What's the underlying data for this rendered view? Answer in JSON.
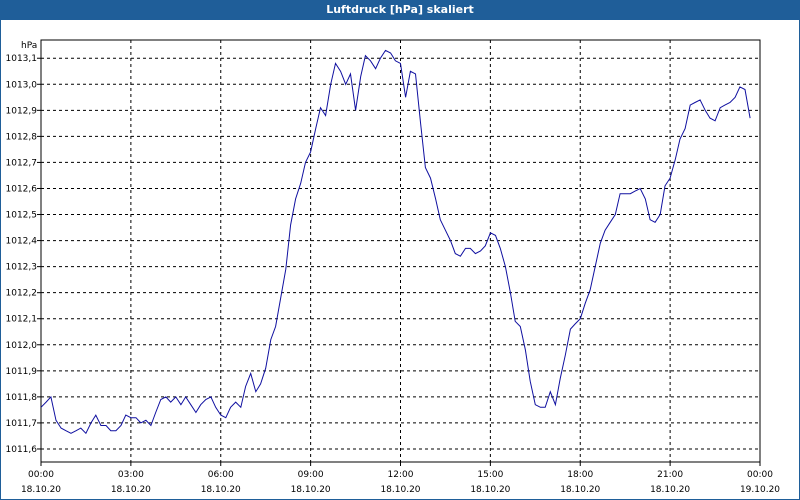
{
  "chart_data": {
    "type": "line",
    "title": "Luftdruck [hPa] skaliert",
    "ylabel": "hPa",
    "xlabel": "",
    "ylim": [
      1011.55,
      1013.17
    ],
    "yticks": [
      "1011,6",
      "1011,7",
      "1011,8",
      "1011,9",
      "1012,0",
      "1012,1",
      "1012,2",
      "1012,3",
      "1012,4",
      "1012,5",
      "1012,6",
      "1012,7",
      "1012,8",
      "1012,9",
      "1013,0",
      "1013,1"
    ],
    "xticks": [
      {
        "time": "00:00",
        "date": "18.10.20"
      },
      {
        "time": "03:00",
        "date": "18.10.20"
      },
      {
        "time": "06:00",
        "date": "18.10.20"
      },
      {
        "time": "09:00",
        "date": "18.10.20"
      },
      {
        "time": "12:00",
        "date": "18.10.20"
      },
      {
        "time": "15:00",
        "date": "18.10.20"
      },
      {
        "time": "18:00",
        "date": "18.10.20"
      },
      {
        "time": "21:00",
        "date": "18.10.20"
      },
      {
        "time": "00:00",
        "date": "19.10.20"
      }
    ],
    "grid": true,
    "line_color": "#1010a0",
    "series": [
      {
        "x_hours": [
          0.0,
          0.17,
          0.33,
          0.5,
          0.67,
          0.83,
          1.0,
          1.17,
          1.33,
          1.5,
          1.67,
          1.83,
          2.0,
          2.17,
          2.33,
          2.5,
          2.67,
          2.83,
          3.0,
          3.17,
          3.33,
          3.5,
          3.67,
          3.83,
          4.0,
          4.17,
          4.33,
          4.5,
          4.67,
          4.83,
          5.0,
          5.17,
          5.33,
          5.5,
          5.67,
          5.83,
          6.0,
          6.17,
          6.33,
          6.5,
          6.67,
          6.83,
          7.0,
          7.17,
          7.33,
          7.5,
          7.67,
          7.83,
          8.0,
          8.17,
          8.33,
          8.5,
          8.67,
          8.83,
          9.0,
          9.17,
          9.33,
          9.5,
          9.67,
          9.83,
          10.0,
          10.17,
          10.33,
          10.5,
          10.67,
          10.83,
          11.0,
          11.17,
          11.33,
          11.5,
          11.67,
          11.83,
          12.0,
          12.17,
          12.33,
          12.5,
          12.67,
          12.83,
          13.0,
          13.17,
          13.33,
          13.5,
          13.67,
          13.83,
          14.0,
          14.17,
          14.33,
          14.5,
          14.67,
          14.83,
          15.0,
          15.17,
          15.33,
          15.5,
          15.67,
          15.83,
          16.0,
          16.17,
          16.33,
          16.5,
          16.67,
          16.83,
          17.0,
          17.17,
          17.33,
          17.5,
          17.67,
          17.83,
          18.0,
          18.17,
          18.33,
          18.5,
          18.67,
          18.83,
          19.0,
          19.17,
          19.33,
          19.5,
          19.67,
          19.83,
          20.0,
          20.17,
          20.33,
          20.5,
          20.67,
          20.83,
          21.0,
          21.17,
          21.33,
          21.5,
          21.67,
          21.83,
          22.0,
          22.17,
          22.33,
          22.5,
          22.67,
          22.83,
          23.0,
          23.17,
          23.33,
          23.5,
          23.67,
          23.83,
          24.0
        ],
        "values": [
          1011.76,
          1011.78,
          1011.8,
          1011.71,
          1011.68,
          1011.67,
          1011.66,
          1011.67,
          1011.68,
          1011.66,
          1011.7,
          1011.73,
          1011.69,
          1011.69,
          1011.67,
          1011.67,
          1011.69,
          1011.73,
          1011.72,
          1011.72,
          1011.7,
          1011.71,
          1011.69,
          1011.74,
          1011.79,
          1011.8,
          1011.78,
          1011.8,
          1011.77,
          1011.8,
          1011.77,
          1011.74,
          1011.77,
          1011.79,
          1011.8,
          1011.76,
          1011.73,
          1011.72,
          1011.76,
          1011.78,
          1011.76,
          1011.84,
          1011.89,
          1011.82,
          1011.85,
          1011.91,
          1012.02,
          1012.07,
          1012.18,
          1012.29,
          1012.46,
          1012.56,
          1012.62,
          1012.7,
          1012.74,
          1012.83,
          1012.91,
          1012.88,
          1013.0,
          1013.08,
          1013.05,
          1013.0,
          1013.04,
          1012.9,
          1013.03,
          1013.11,
          1013.09,
          1013.06,
          1013.1,
          1013.13,
          1013.12,
          1013.09,
          1013.08,
          1012.95,
          1013.05,
          1013.04,
          1012.85,
          1012.68,
          1012.64,
          1012.56,
          1012.48,
          1012.44,
          1012.4,
          1012.35,
          1012.34,
          1012.37,
          1012.37,
          1012.35,
          1012.36,
          1012.38,
          1012.43,
          1012.42,
          1012.37,
          1012.3,
          1012.2,
          1012.09,
          1012.07,
          1011.98,
          1011.86,
          1011.77,
          1011.76,
          1011.76,
          1011.82,
          1011.77,
          1011.87,
          1011.96,
          1012.06,
          1012.08,
          1012.1,
          1012.16,
          1012.21,
          1012.3,
          1012.39,
          1012.44,
          1012.47,
          1012.5,
          1012.58,
          1012.58,
          1012.58,
          1012.59,
          1012.6,
          1012.56,
          1012.48,
          1012.47,
          1012.5,
          1012.61,
          1012.64,
          1012.71,
          1012.79,
          1012.83,
          1012.92,
          1012.93,
          1012.94,
          1012.9,
          1012.87,
          1012.86,
          1012.91,
          1012.92,
          1012.93,
          1012.95,
          1012.99,
          1012.98,
          1012.87
        ]
      }
    ]
  }
}
